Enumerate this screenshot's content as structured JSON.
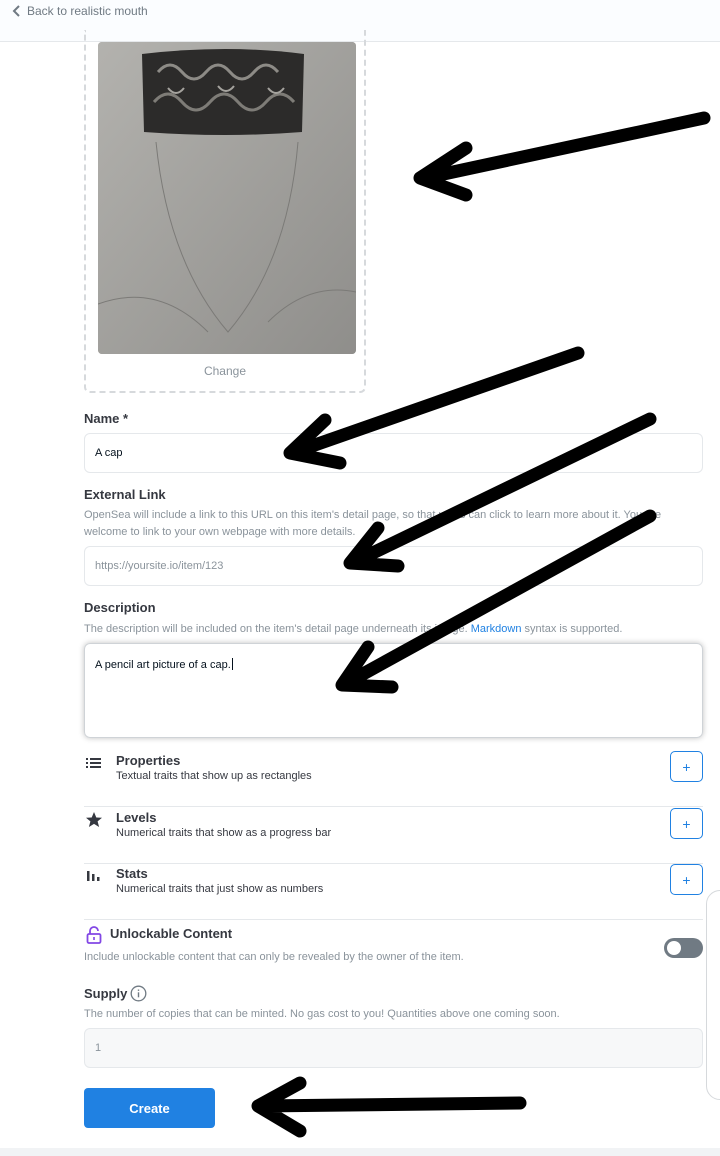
{
  "nav": {
    "back_label": "Back to realistic mouth"
  },
  "media": {
    "change_label": "Change"
  },
  "name_field": {
    "label": "Name *",
    "value": "A cap"
  },
  "external_link": {
    "label": "External Link",
    "helper": "OpenSea will include a link to this URL on this item's detail page, so that users can click to learn more about it. You are welcome to link to your own webpage with more details.",
    "placeholder": "https://yoursite.io/item/123"
  },
  "description": {
    "label": "Description",
    "helper_before": "The description will be included on the item's detail page underneath its image.",
    "helper_link": "Markdown",
    "helper_after": "syntax is supported.",
    "value": "A pencil art picture of a cap."
  },
  "traits": [
    {
      "title": "Properties",
      "subtitle": "Textual traits that show up as rectangles",
      "icon": "list-icon",
      "button": "+"
    },
    {
      "title": "Levels",
      "subtitle": "Numerical traits that show as a progress bar",
      "icon": "star-icon",
      "button": "+"
    },
    {
      "title": "Stats",
      "subtitle": "Numerical traits that just show as numbers",
      "icon": "bar-chart-icon",
      "button": "+"
    }
  ],
  "unlockable": {
    "title": "Unlockable Content",
    "helper": "Include unlockable content that can only be revealed by the owner of the item.",
    "icon": "lock-icon",
    "enabled": false
  },
  "supply": {
    "label": "Supply",
    "icon": "info-icon",
    "helper": "The number of copies that can be minted. No gas cost to you! Quantities above one coming soon.",
    "value": "1"
  },
  "create_button": {
    "label": "Create"
  },
  "colors": {
    "accent": "#2081e2",
    "toggle_off": "#707a83",
    "text": "#353840",
    "muted": "#8a939b"
  }
}
